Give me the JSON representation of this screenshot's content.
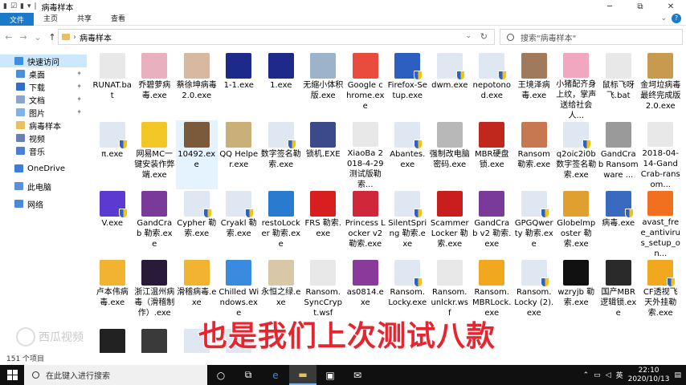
{
  "window": {
    "title": "病毒样本",
    "controls": {
      "min": "─",
      "max": "⧉",
      "close": "✕"
    }
  },
  "ribbon": {
    "tabs": [
      "文件",
      "主页",
      "共享",
      "查看"
    ],
    "expand": "⌄",
    "help": "?"
  },
  "address": {
    "path": "病毒样本",
    "search_placeholder": "搜索\"病毒样本\""
  },
  "sidebar": {
    "items": [
      {
        "label": "快速访问",
        "color": "#3f8ee3",
        "pinned": false
      },
      {
        "label": "桌面",
        "color": "#4a90d9",
        "pinned": true
      },
      {
        "label": "下载",
        "color": "#2f6fc6",
        "pinned": true
      },
      {
        "label": "文档",
        "color": "#8aa6c9",
        "pinned": true
      },
      {
        "label": "图片",
        "color": "#7fb2e5",
        "pinned": true
      },
      {
        "label": "病毒样本",
        "color": "#e9c060",
        "pinned": false
      },
      {
        "label": "视频",
        "color": "#6a7fb5",
        "pinned": false
      },
      {
        "label": "音乐",
        "color": "#4d7fd0",
        "pinned": false
      },
      {
        "label": "OneDrive",
        "color": "#3d7fd6",
        "pinned": false
      },
      {
        "label": "此电脑",
        "color": "#5c8fd8",
        "pinned": false
      },
      {
        "label": "网络",
        "color": "#4a8ad8",
        "pinned": false
      }
    ]
  },
  "files": [
    {
      "name": "RUNAT.bat",
      "color": "#e8e8e8",
      "shield": false
    },
    {
      "name": "乔碧萝病毒.exe",
      "color": "#e9b0c0",
      "shield": false
    },
    {
      "name": "蔡徐坤病毒2.0.exe",
      "color": "#d8b8a0",
      "shield": false
    },
    {
      "name": "1-1.exe",
      "color": "#1e2a8a",
      "shield": false
    },
    {
      "name": "1.exe",
      "color": "#1e2a8a",
      "shield": false
    },
    {
      "name": "无缩小体积版.exe",
      "color": "#9bb4c9",
      "shield": false
    },
    {
      "name": "Google chrome.exe",
      "color": "#e94b3c",
      "shield": false
    },
    {
      "name": "Firefox-Setup.exe",
      "color": "#2d5fc0",
      "shield": true
    },
    {
      "name": "dwm.exe",
      "color": "#dfe7f2",
      "shield": true
    },
    {
      "name": "nepotonod.exe",
      "color": "#dfe7f2",
      "shield": true
    },
    {
      "name": "王境泽病毒.exe",
      "color": "#a07a5a",
      "shield": false
    },
    {
      "name": "小猪配齐身上纹，掌声送给社会人...",
      "color": "#f2a7c0",
      "shield": false
    },
    {
      "name": "鼠标飞呀飞.bat",
      "color": "#e8e8e8",
      "shield": false
    },
    {
      "name": "金坷垃病毒最终完成版2.0.exe",
      "color": "#c89a50",
      "shield": false
    },
    {
      "name": "π.exe",
      "color": "#dfe7f2",
      "shield": true
    },
    {
      "name": "网易MC一键安装作弊端.exe",
      "color": "#f3c726",
      "shield": false
    },
    {
      "name": "10492.exe",
      "color": "#7a5a3a",
      "shield": false
    },
    {
      "name": "QQ Helper.exe",
      "color": "#c9b078",
      "shield": false
    },
    {
      "name": "数字签名勒索.exe",
      "color": "#dfe7f2",
      "shield": true
    },
    {
      "name": "锁机.EXE",
      "color": "#3a4a8a",
      "shield": false
    },
    {
      "name": "XiaoBa 2018-4-29测试版勒索...",
      "color": "#e8e8e8",
      "shield": false
    },
    {
      "name": "Abantes.exe",
      "color": "#dfe7f2",
      "shield": true
    },
    {
      "name": "强制改电脑密码.exe",
      "color": "#b8b8b8",
      "shield": false
    },
    {
      "name": "MBR硬盘锁.exe",
      "color": "#c0281e",
      "shield": false
    },
    {
      "name": "Ransom勒索.exe",
      "color": "#c87850",
      "shield": false
    },
    {
      "name": "q2oic2i0b 数字签名勒索.exe",
      "color": "#dfe7f2",
      "shield": true
    },
    {
      "name": "GandCrab Ransomware ...",
      "color": "#9a9a9a",
      "shield": false
    },
    {
      "name": "2018-04-14-GandCrab-ransom...",
      "color": "#e8e8e8",
      "shield": false
    },
    {
      "name": "V.exe",
      "color": "#5a3ad0",
      "shield": true
    },
    {
      "name": "GandCrab 勒索.exe",
      "color": "#7a3a9a",
      "shield": false
    },
    {
      "name": "Cypher 勒索.exe",
      "color": "#dfe7f2",
      "shield": true
    },
    {
      "name": "Cryakl 勒索.exe",
      "color": "#dfe7f2",
      "shield": true
    },
    {
      "name": "restoLocker 勒索.exe",
      "color": "#2a7ad0",
      "shield": false
    },
    {
      "name": "FRS 勒索.exe",
      "color": "#d81e1e",
      "shield": false
    },
    {
      "name": "Princess Locker v2 勒索.exe",
      "color": "#d0283a",
      "shield": false
    },
    {
      "name": "SilentSpring 勒索.exe",
      "color": "#dfe7f2",
      "shield": true
    },
    {
      "name": "ScammerLocker 勒索.exe",
      "color": "#c81e1e",
      "shield": false
    },
    {
      "name": "GandCrab v2 勒索.exe",
      "color": "#7a3a9a",
      "shield": false
    },
    {
      "name": "GPGQwerty 勒索.exe",
      "color": "#dfe7f2",
      "shield": true
    },
    {
      "name": "Globelmposter 勒索.exe",
      "color": "#e0a030",
      "shield": false
    },
    {
      "name": "病毒.exe",
      "color": "#3a6ac0",
      "shield": true
    },
    {
      "name": "avast_free_antivirus_setup_on...",
      "color": "#f07020",
      "shield": false
    },
    {
      "name": "卢本伟病毒.exe",
      "color": "#f2b430",
      "shield": false
    },
    {
      "name": "浙江温州病毒（滑稽制作）.exe",
      "color": "#2a1a3a",
      "shield": false
    },
    {
      "name": "滑稽病毒.exe",
      "color": "#f2b430",
      "shield": false
    },
    {
      "name": "Chilled Windows.exe",
      "color": "#3a8ae0",
      "shield": false
    },
    {
      "name": "永恒之绿.exe",
      "color": "#d8c8a8",
      "shield": false
    },
    {
      "name": "Ransom. SyncCrypt.wsf",
      "color": "#e8e8e8",
      "shield": false
    },
    {
      "name": "as0814.exe",
      "color": "#8a3a9a",
      "shield": false
    },
    {
      "name": "Ransom. Locky.exe",
      "color": "#dfe7f2",
      "shield": true
    },
    {
      "name": "Ransom. unlckr.wsf",
      "color": "#e8e8e8",
      "shield": false
    },
    {
      "name": "Ransom. MBRLock.exe",
      "color": "#f2a81e",
      "shield": false
    },
    {
      "name": "Ransom. Locky (2).exe",
      "color": "#dfe7f2",
      "shield": true
    },
    {
      "name": "wzryjb 勒索.exe",
      "color": "#111111",
      "shield": false
    },
    {
      "name": "国产MBR逻辑锁.exe",
      "color": "#2a2a2a",
      "shield": false
    },
    {
      "name": "CF透视飞天外挂勒索.exe",
      "color": "#f2a81e",
      "shield": true
    },
    {
      "name": "",
      "color": "#222222",
      "shield": false
    },
    {
      "name": "",
      "color": "#3a3a3a",
      "shield": false
    },
    {
      "name": "",
      "color": "#dfe7f2",
      "shield": false
    },
    {
      "name": "",
      "color": "#dfe7f2",
      "shield": false
    }
  ],
  "status": {
    "count": "151 个项目"
  },
  "caption": "也是我们上次测试八款",
  "watermark": "西瓜视频",
  "taskbar": {
    "search_placeholder": "在此键入进行搜索",
    "time": "22:10",
    "date": "2020/10/13",
    "ime": "英"
  }
}
